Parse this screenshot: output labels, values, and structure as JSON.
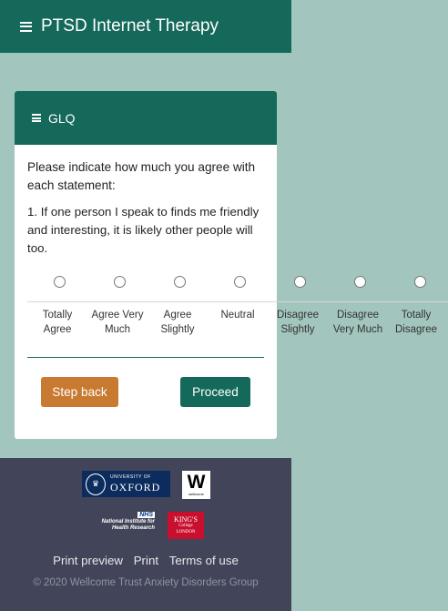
{
  "app": {
    "title": "PTSD Internet Therapy",
    "menu_icon": "hamburger-menu-icon"
  },
  "card": {
    "header": "GLQ",
    "instruction": "Please indicate how much you agree with each statement:",
    "question": "1. If one person I speak to finds me friendly and interesting, it is likely other people will too.",
    "options": [
      {
        "line1": "Totally",
        "line2": "Agree"
      },
      {
        "line1": "Agree Very",
        "line2": "Much"
      },
      {
        "line1": "Agree",
        "line2": "Slightly"
      },
      {
        "line1": "Neutral",
        "line2": ""
      },
      {
        "line1": "Disagree",
        "line2": "Slightly"
      },
      {
        "line1": "Disagree",
        "line2": "Very Much"
      },
      {
        "line1": "Totally",
        "line2": "Disagree"
      }
    ],
    "back_label": "Step back",
    "proceed_label": "Proceed"
  },
  "colors": {
    "primary": "#14695a",
    "background": "#a2c5bd",
    "back_button": "#c87a30",
    "footer": "#424559"
  },
  "footer": {
    "oxford_small": "UNIVERSITY OF",
    "oxford_big": "OXFORD",
    "wellcome_mark": "W",
    "wellcome_text": "wellcome",
    "nhs": "NHS",
    "nihr_line1": "National Institute for",
    "nihr_line2": "Health Research",
    "kings_line1": "KING'S",
    "kings_line2": "College",
    "kings_line3": "LONDON",
    "links": [
      "Print preview",
      "Print",
      "Terms of use"
    ],
    "copyright": "© 2020 Wellcome Trust Anxiety Disorders Group"
  }
}
